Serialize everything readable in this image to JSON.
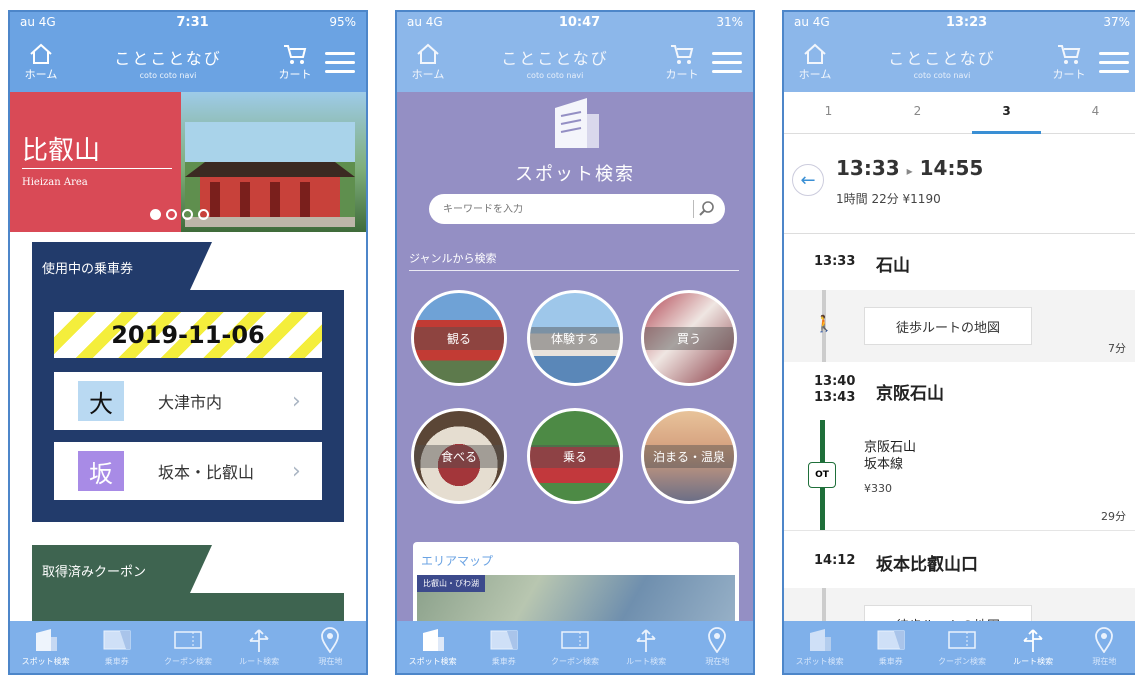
{
  "header": {
    "home_label": "ホーム",
    "brand_title": "ことことなび",
    "brand_sub": "coto coto navi",
    "cart_label": "カート"
  },
  "tabs": [
    {
      "label": "スポット検索",
      "icon": "building-icon"
    },
    {
      "label": "乗車券",
      "icon": "ticket-icon"
    },
    {
      "label": "クーポン検索",
      "icon": "coupon-icon"
    },
    {
      "label": "ルート検索",
      "icon": "route-icon"
    },
    {
      "label": "現在地",
      "icon": "location-pin-icon"
    }
  ],
  "screen1": {
    "status": {
      "carrier": "au 4G",
      "time": "7:31",
      "battery": "95%"
    },
    "hero": {
      "title": "比叡山",
      "subtitle": "Hieizan Area",
      "page_count": 4,
      "active_page": 1
    },
    "tickets_heading": "使用中の乗車券",
    "ticket_date": "2019-11-06",
    "routes": [
      {
        "kanji": "大",
        "name": "大津市内",
        "badge_color": "#b9d9f2"
      },
      {
        "kanji": "坂",
        "name": "坂本・比叡山",
        "badge_color": "#a88be6"
      }
    ],
    "coupons_heading": "取得済みクーポン"
  },
  "screen2": {
    "status": {
      "carrier": "au 4G",
      "time": "10:47",
      "battery": "31%"
    },
    "title": "スポット検索",
    "search_placeholder": "キーワードを入力",
    "genre_heading": "ジャンルから検索",
    "genres": [
      "観る",
      "体験する",
      "買う",
      "食べる",
      "乗る",
      "泊まる・温泉"
    ],
    "area_map_heading": "エリアマップ",
    "area_map_label": "比叡山・びわ湖"
  },
  "screen3": {
    "status": {
      "carrier": "au 4G",
      "time": "13:23",
      "battery": "37%"
    },
    "steps": [
      "1",
      "2",
      "3",
      "4"
    ],
    "active_step": "3",
    "depart": "13:33",
    "arrive": "14:55",
    "summary": "1時間 22分  ¥1190",
    "stops": [
      {
        "time": "13:33",
        "name": "石山"
      },
      {
        "time": "13:40",
        "time2": "13:43",
        "name": "京阪石山"
      },
      {
        "time": "14:12",
        "name": "坂本比叡山口"
      }
    ],
    "walk_button": "徒歩ルートの地図",
    "walk_duration": "7分",
    "train_line": "京阪石山",
    "train_line2": "坂本線",
    "train_fare": "¥330",
    "train_code": "OT",
    "train_duration": "29分"
  }
}
